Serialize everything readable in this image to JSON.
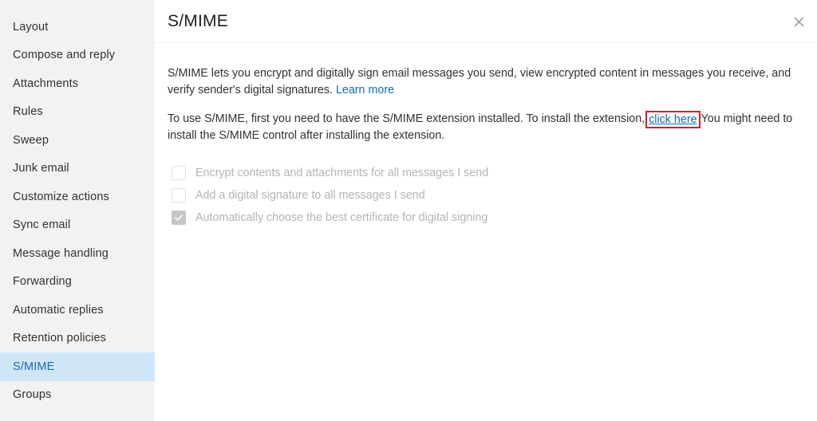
{
  "sidebar": {
    "items": [
      {
        "label": "Layout",
        "selected": false
      },
      {
        "label": "Compose and reply",
        "selected": false
      },
      {
        "label": "Attachments",
        "selected": false
      },
      {
        "label": "Rules",
        "selected": false
      },
      {
        "label": "Sweep",
        "selected": false
      },
      {
        "label": "Junk email",
        "selected": false
      },
      {
        "label": "Customize actions",
        "selected": false
      },
      {
        "label": "Sync email",
        "selected": false
      },
      {
        "label": "Message handling",
        "selected": false
      },
      {
        "label": "Forwarding",
        "selected": false
      },
      {
        "label": "Automatic replies",
        "selected": false
      },
      {
        "label": "Retention policies",
        "selected": false
      },
      {
        "label": "S/MIME",
        "selected": true
      },
      {
        "label": "Groups",
        "selected": false
      }
    ]
  },
  "header": {
    "title": "S/MIME",
    "close_icon": "close-icon"
  },
  "main": {
    "paragraph1": {
      "text_before_link": "S/MIME lets you encrypt and digitally sign email messages you send, view encrypted content in messages you receive, and verify sender's digital signatures. ",
      "link_label": "Learn more"
    },
    "paragraph2": {
      "text_before_link": "To use S/MIME, first you need to have the S/MIME extension installed. To install the extension,",
      "link_label": "click here",
      "text_after_link": "You might need to install the S/MIME control after installing the extension."
    },
    "checkboxes": [
      {
        "label": "Encrypt contents and attachments for all messages I send",
        "checked": false,
        "disabled": true
      },
      {
        "label": "Add a digital signature to all messages I send",
        "checked": false,
        "disabled": true
      },
      {
        "label": "Automatically choose the best certificate for digital signing",
        "checked": true,
        "disabled": true
      }
    ]
  },
  "colors": {
    "sidebar_background": "#f3f2f1",
    "selected_item_background": "#cfe6f8",
    "selected_item_text": "#1a6bb8",
    "link": "#0f6cbd",
    "highlight_border": "#cc2229",
    "body_text": "#323130",
    "disabled_text": "#b6b4b2",
    "checked_box": "#c8c6c4"
  }
}
